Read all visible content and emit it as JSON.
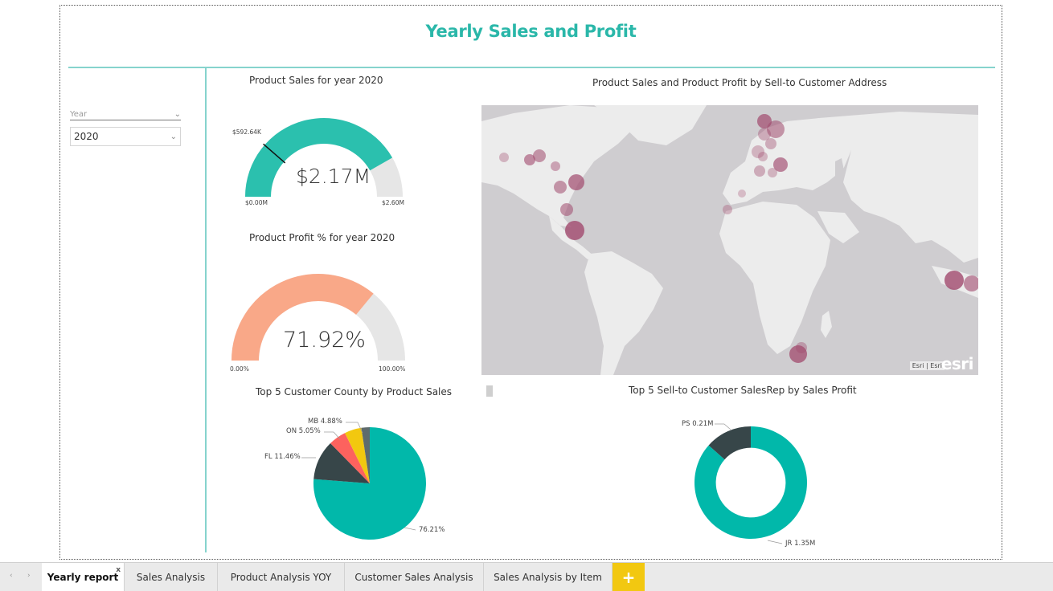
{
  "report": {
    "title": "Yearly Sales and Profit"
  },
  "slicer": {
    "header": "Year",
    "selected": "2020"
  },
  "gauge_sales": {
    "title": "Product Sales for year 2020",
    "value_label": "$2.17M",
    "target_label": "$592.64K",
    "min_label": "$0.00M",
    "max_label": "$2.60M",
    "value": 2.17,
    "target": 0.59264,
    "min": 0,
    "max": 2.6,
    "fill_color": "#2bc0ae",
    "track_color": "#e6e6e6"
  },
  "gauge_profit": {
    "title": "Product Profit % for year 2020",
    "value_label": "71.92%",
    "min_label": "0.00%",
    "max_label": "100.00%",
    "value": 71.92,
    "min": 0,
    "max": 100,
    "fill_color": "#f9a888",
    "track_color": "#e6e6e6"
  },
  "map": {
    "title": "Product Sales and Product Profit by Sell-to Customer Address",
    "attribution": "Esri | Esri",
    "logo_text": "esri",
    "bubble_color": "#a14a6e",
    "water_color": "#cfcdd0",
    "land_color": "#ececec"
  },
  "pie_county": {
    "title": "Top 5 Customer County by Product Sales",
    "labels": [
      "MB 4.88%",
      "ON 5.05%",
      "FL 11.46%",
      "76.21%"
    ]
  },
  "donut_salesrep": {
    "title": "Top 5 Sell-to Customer SalesRep by Sales Profit",
    "labels": [
      "PS 0.21M",
      "JR 1.35M"
    ]
  },
  "chart_data": [
    {
      "type": "pie",
      "title": "Top 5 Customer County by Product Sales",
      "categories": [
        "",
        "FL",
        "ON",
        "MB",
        ""
      ],
      "values": [
        76.21,
        11.46,
        5.05,
        4.88,
        2.4
      ],
      "colors": [
        "#01b8aa",
        "#374649",
        "#fd625e",
        "#f2c80f",
        "#5f6b6d"
      ]
    },
    {
      "type": "pie",
      "title": "Top 5 Sell-to Customer SalesRep by Sales Profit",
      "categories": [
        "JR",
        "PS"
      ],
      "values": [
        1.35,
        0.21
      ],
      "colors": [
        "#01b8aa",
        "#374649"
      ]
    }
  ],
  "tabs": {
    "prev_arrow": "‹",
    "next_arrow": "›",
    "items": [
      {
        "label": "Yearly report",
        "close": "x"
      },
      {
        "label": "Sales Analysis"
      },
      {
        "label": "Product Analysis YOY"
      },
      {
        "label": "Customer Sales Analysis"
      },
      {
        "label": "Sales Analysis by Item"
      }
    ],
    "add_label": "+"
  }
}
